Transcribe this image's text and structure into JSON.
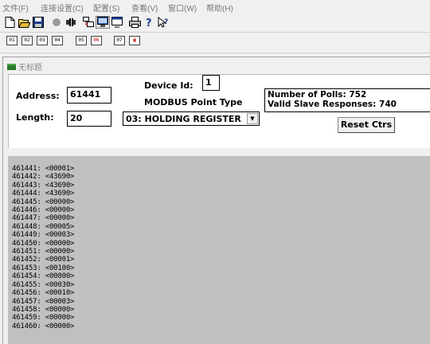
{
  "menu": [
    "文件(F)",
    "连接设置(C)",
    "配置(S)",
    "查看(V)",
    "窗口(W)",
    "帮助(H)"
  ],
  "toolbar2": {
    "buttons": [
      "01",
      "02",
      "03",
      "04",
      "05",
      "06",
      "07"
    ]
  },
  "window": {
    "title": "无标题"
  },
  "form": {
    "address_label": "Address:",
    "address_value": "61441",
    "length_label": "Length:",
    "length_value": "20",
    "device_id_label": "Device Id:",
    "device_id_value": "1",
    "point_type_label": "MODBUS Point Type",
    "point_type_value": "03: HOLDING REGISTER",
    "polls_line": "Number of Polls: 752",
    "responses_line": "Valid Slave Responses: 740",
    "reset_label": "Reset Ctrs"
  },
  "registers": [
    {
      "addr": "461441",
      "value": "<00001>"
    },
    {
      "addr": "461442",
      "value": "<43690>"
    },
    {
      "addr": "461443",
      "value": "<43690>"
    },
    {
      "addr": "461444",
      "value": "<43690>"
    },
    {
      "addr": "461445",
      "value": "<00000>"
    },
    {
      "addr": "461446",
      "value": "<00000>"
    },
    {
      "addr": "461447",
      "value": "<00000>"
    },
    {
      "addr": "461448",
      "value": "<00005>"
    },
    {
      "addr": "461449",
      "value": "<00003>"
    },
    {
      "addr": "461450",
      "value": "<00000>"
    },
    {
      "addr": "461451",
      "value": "<00000>"
    },
    {
      "addr": "461452",
      "value": "<00001>"
    },
    {
      "addr": "461453",
      "value": "<00100>"
    },
    {
      "addr": "461454",
      "value": "<00800>"
    },
    {
      "addr": "461455",
      "value": "<00030>"
    },
    {
      "addr": "461456",
      "value": "<00010>"
    },
    {
      "addr": "461457",
      "value": "<00003>"
    },
    {
      "addr": "461458",
      "value": "<00000>"
    },
    {
      "addr": "461459",
      "value": "<00000>"
    },
    {
      "addr": "461460",
      "value": "<00000>"
    }
  ],
  "icons": {
    "toolbar1": [
      "new-file-icon",
      "open-folder-icon",
      "save-icon",
      "connect-icon",
      "disconnect-icon",
      "display-registers-icon",
      "monitor-icon",
      "window-icon",
      "print-icon",
      "help-icon",
      "context-help-icon"
    ]
  }
}
